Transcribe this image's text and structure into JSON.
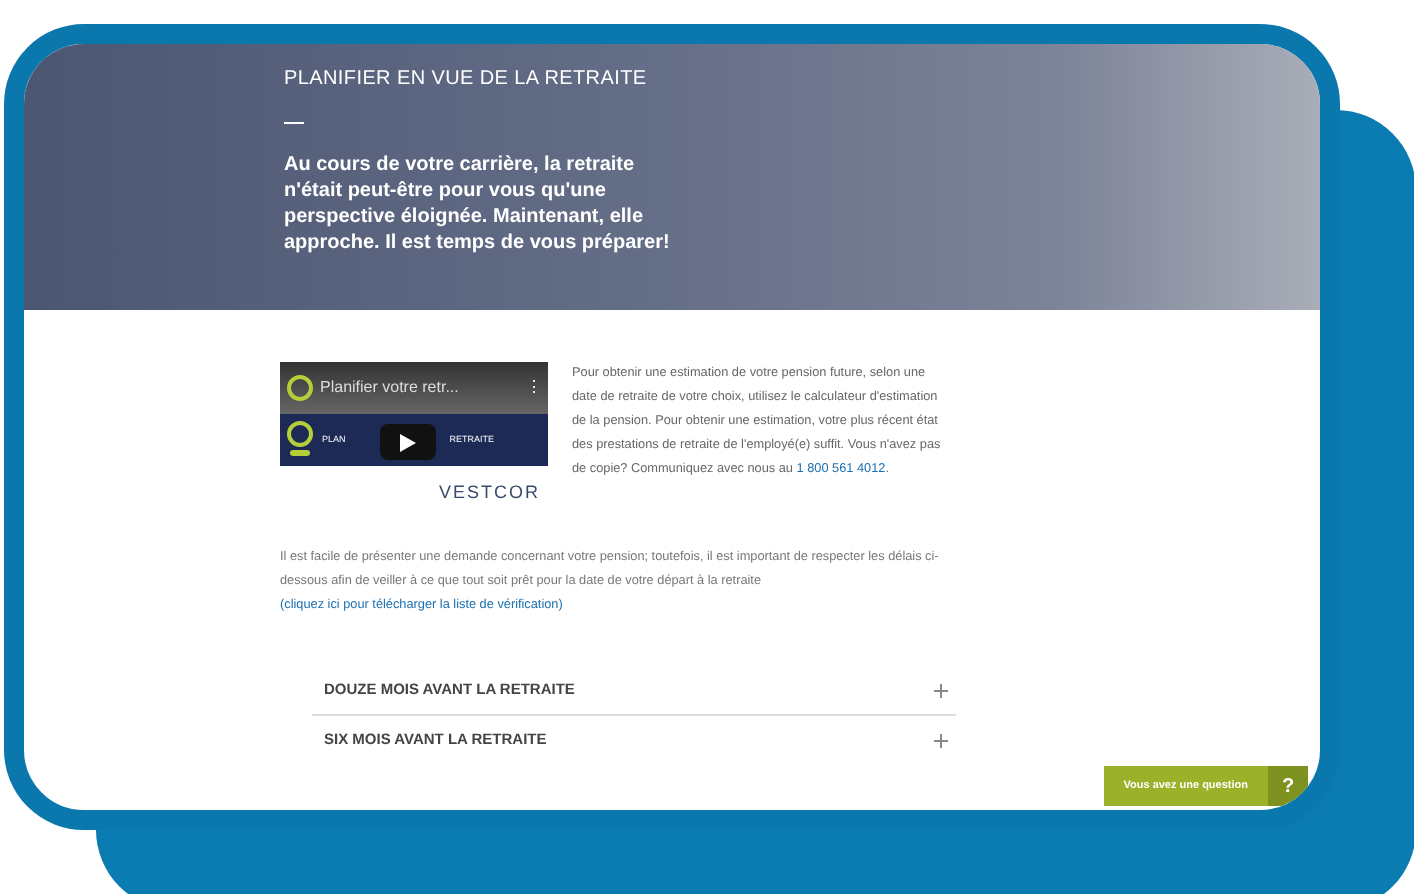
{
  "hero": {
    "title": "PLANIFIER EN VUE DE LA RETRAITE",
    "text": "Au cours de votre carrière, la retraite n'était peut-être pour vous qu'une perspective éloignée. Maintenant, elle approche. Il est temps de vous préparer!"
  },
  "video": {
    "title": "Planifier votre retr...",
    "menu": "⋮",
    "banner_left": "PLAN",
    "banner_right": "RETRAITE",
    "brand": "VESTCOR"
  },
  "intro": {
    "text": "Pour obtenir une estimation de votre pension future, selon une date de retraite de votre choix, utilisez le calculateur d'estimation de la pension. Pour obtenir une estimation, votre plus récent état des prestations de retraite de l'employé(e) suffit. Vous n'avez pas de copie? Communiquez avec nous au",
    "phone": "1 800 561 4012",
    "end": "."
  },
  "notice": {
    "text": "Il est facile de présenter une demande concernant votre pension; toutefois, il est important de respecter les délais ci-dessous afin de veiller à ce que tout soit prêt pour la date de votre départ à la retraite",
    "link": "(cliquez ici pour télécharger la liste de vérification)"
  },
  "accordion": [
    {
      "label": "DOUZE MOIS AVANT LA RETRAITE",
      "expanded": false
    },
    {
      "label": "SIX MOIS AVANT LA RETRAITE",
      "expanded": false
    }
  ],
  "chat": {
    "label": "Vous avez une question",
    "icon": "?"
  }
}
